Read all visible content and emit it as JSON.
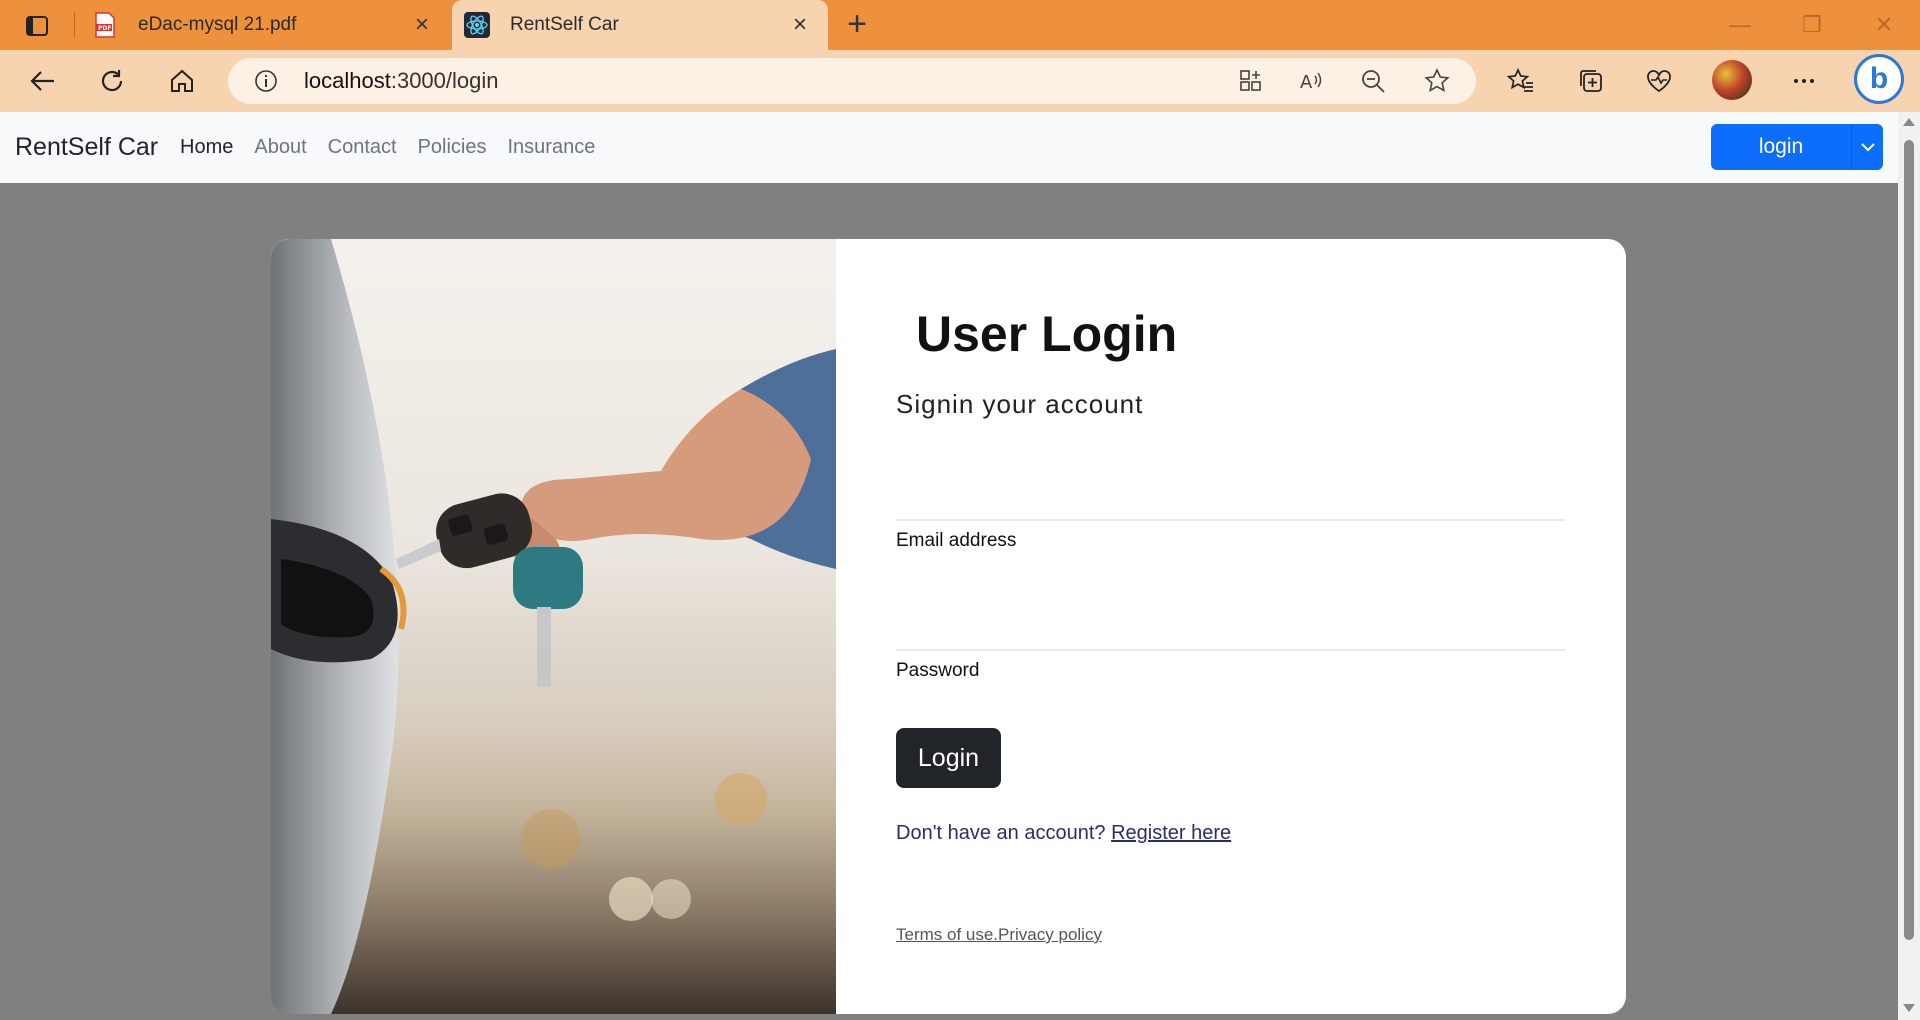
{
  "browser": {
    "tabs": [
      {
        "title": "eDac-mysql 21.pdf",
        "favicon": "pdf-icon"
      },
      {
        "title": "RentSelf Car",
        "favicon": "react-icon",
        "active": true
      }
    ],
    "url": {
      "host": "localhost",
      "path": ":3000/login"
    },
    "colors": {
      "titlebar": "#ee913d",
      "toolbar": "#f7d3b0",
      "addressbar": "#fdf0e5"
    }
  },
  "navbar": {
    "brand": "RentSelf Car",
    "links": [
      "Home",
      "About",
      "Contact",
      "Policies",
      "Insurance"
    ],
    "active_link": "Home",
    "login_button": "login",
    "accent": "#0d6efd"
  },
  "login": {
    "title": "User Login",
    "subtitle": "Signin your account",
    "email_label": "Email address",
    "password_label": "Password",
    "submit": "Login",
    "register_prompt": "Don't have an account?",
    "register_link": "Register here",
    "terms": "Terms of use.Privacy policy"
  }
}
